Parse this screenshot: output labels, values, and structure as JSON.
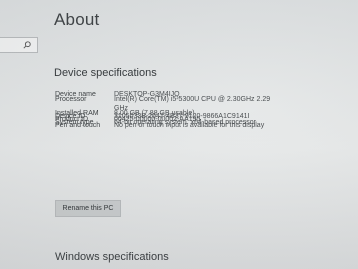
{
  "page": {
    "title": "About"
  },
  "search": {
    "placeholder": ""
  },
  "device_specs": {
    "heading": "Device specifications",
    "rows": [
      {
        "label": "Device name",
        "value": "DESKTOP-G3M4IJQ"
      },
      {
        "label": "Processor",
        "value": "Intel(R) Core(TM) i5-5300U CPU @ 2.30GHz   2.29 GHz"
      },
      {
        "label": "Installed RAM",
        "value": "8.00 GB (7.88 GB usable)"
      },
      {
        "label": "Device ID",
        "value": "3105033B-2647-4B37-9120-9866A1C9141I"
      },
      {
        "label": "Product ID",
        "value": "00425-00000-00002-AA195"
      },
      {
        "label": "System type",
        "value": "64-bit operating system, x64-based processor"
      },
      {
        "label": "Pen and touch",
        "value": "No pen or touch input is available for this display"
      }
    ],
    "rename_label": "Rename this PC"
  },
  "windows_specs": {
    "heading": "Windows specifications"
  }
}
